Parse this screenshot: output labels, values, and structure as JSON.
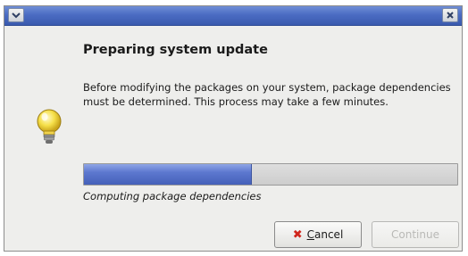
{
  "dialog": {
    "heading": "Preparing system update",
    "message": "Before modifying the packages on your system, package dependencies must be determined. This process may take a few minutes.",
    "status": "Computing package dependencies",
    "progress_percent": 45
  },
  "titlebar": {
    "menu_icon": "chevron-down-icon",
    "close_icon": "close-icon",
    "color": "#4b6cc3"
  },
  "buttons": {
    "cancel": {
      "mnemonic": "C",
      "rest": "ancel",
      "icon": "x-icon"
    },
    "continue": {
      "label": "Continue",
      "enabled": false
    }
  },
  "colors": {
    "progress_fill": "#5d78cf",
    "cancel_icon": "#d0261c"
  },
  "icons": {
    "message": "lightbulb-icon"
  }
}
